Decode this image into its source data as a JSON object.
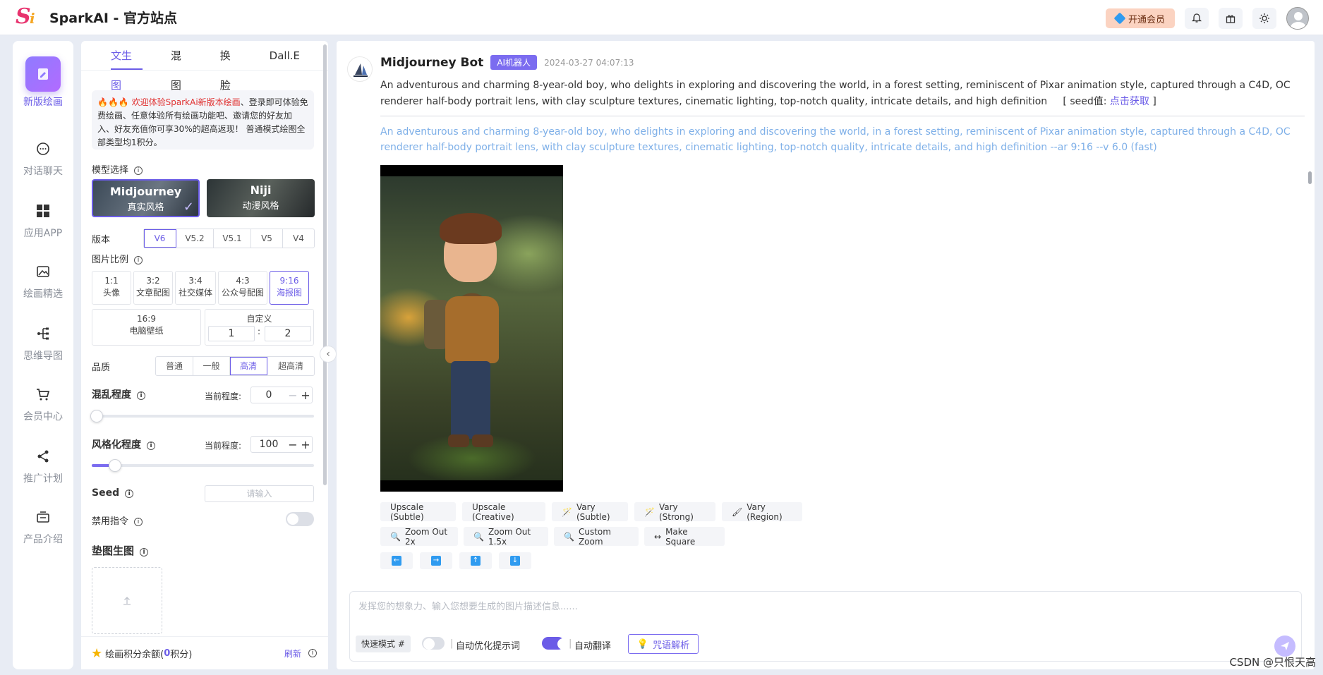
{
  "app": {
    "title": "SparkAI - 官方站点",
    "logo_s": "S",
    "logo_i": "i"
  },
  "header": {
    "vip_label": "开通会员"
  },
  "nav": {
    "items": [
      {
        "label": "新版绘画"
      },
      {
        "label": "对话聊天"
      },
      {
        "label": "应用APP"
      },
      {
        "label": "绘画精选"
      },
      {
        "label": "思维导图"
      },
      {
        "label": "会员中心"
      },
      {
        "label": "推广计划"
      },
      {
        "label": "产品介绍"
      }
    ]
  },
  "panel": {
    "tabs": [
      "文生图",
      "混图",
      "换脸",
      "Dall.E"
    ],
    "notice": {
      "fires": "🔥🔥🔥",
      "red": "欢迎体验SparkAi新版本绘画",
      "rest": "、登录即可体验免费绘画、任意体验所有绘画功能吧、邀请您的好友加入、好友充值你可享30%的超高返现！ 普通模式绘图全部类型均1积分。"
    },
    "model_label": "模型选择",
    "models": [
      {
        "name": "Midjourney",
        "sub": "真实风格"
      },
      {
        "name": "Niji",
        "sub": "动漫风格"
      }
    ],
    "version_label": "版本",
    "versions": [
      "V6",
      "V5.2",
      "V5.1",
      "V5",
      "V4"
    ],
    "ratio_label": "图片比例",
    "ratios": [
      {
        "r": "1:1",
        "d": "头像"
      },
      {
        "r": "3:2",
        "d": "文章配图"
      },
      {
        "r": "3:4",
        "d": "社交媒体"
      },
      {
        "r": "4:3",
        "d": "公众号配图"
      },
      {
        "r": "9:16",
        "d": "海报图"
      }
    ],
    "ratio_wide": {
      "r": "16:9",
      "d": "电脑壁纸"
    },
    "custom": {
      "label": "自定义",
      "w": "1",
      "h": "2",
      "colon": ":"
    },
    "quality_label": "品质",
    "qualities": [
      "普通",
      "一般",
      "高清",
      "超高清"
    ],
    "chaos_label": "混乱程度",
    "current_label": "当前程度:",
    "chaos_value": "0",
    "stylize_label": "风格化程度",
    "stylize_value": "100",
    "seed_label": "Seed",
    "seed_placeholder": "请输入",
    "ban_label": "禁用指令",
    "pad_label": "垫图生图",
    "credit_label": "绘画积分余额(",
    "credit_value": "0",
    "credit_unit": "积分)",
    "refresh": "刷新"
  },
  "message": {
    "bot": "Midjourney Bot",
    "badge": "AI机器人",
    "time": "2024-03-27 04:07:13",
    "prompt": "An adventurous and charming 8-year-old boy, who delights in exploring and discovering the world, in a forest setting, reminiscent of Pixar animation style, captured through a C4D, OC renderer half-body portrait lens, with clay sculpture textures, cinematic lighting, top-notch quality, intricate details, and high definition",
    "seed_prefix": "[ seed值:",
    "seed_link": "点击获取",
    "seed_suffix": "]",
    "prompt_full": "An adventurous and charming 8-year-old boy, who delights in exploring and discovering the world, in a forest setting, reminiscent of Pixar animation style, captured through a C4D, OC renderer half-body portrait lens, with clay sculpture textures, cinematic lighting, top-notch quality, intricate details, and high definition --ar 9:16 --v 6.0  (fast)",
    "actions_row1": [
      "Upscale (Subtle)",
      "Upscale (Creative)",
      "Vary (Subtle)",
      "Vary (Strong)",
      "Vary (Region)"
    ],
    "actions_row2": [
      "Zoom Out 2x",
      "Zoom Out 1.5x",
      "Custom Zoom",
      "Make Square"
    ]
  },
  "composer": {
    "placeholder": "发挥您的想象力、输入您想要生成的图片描述信息......",
    "mode": "快速模式 #",
    "auto_optimize": "自动优化提示词",
    "auto_translate": "自动翻译",
    "spell": "咒语解析"
  },
  "watermark": "CSDN @只恨天高"
}
